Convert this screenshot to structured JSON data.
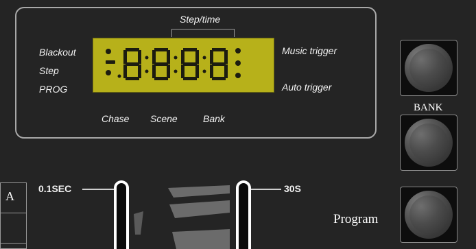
{
  "display": {
    "top_label": "Step/time",
    "left_labels": [
      "Blackout",
      "Step",
      "PROG"
    ],
    "right_labels": [
      "Music trigger",
      "Auto trigger"
    ],
    "bottom_labels": [
      "Chase",
      "Scene",
      "Bank"
    ],
    "segment_text": "8:8:8:8",
    "colors": {
      "lcd": "#b7b11a",
      "segments": "#1c1c10",
      "panel": "#242424"
    }
  },
  "buttons": {
    "bank_label": "BANK",
    "program_label": "Program",
    "side_mark": "A"
  },
  "faders": {
    "min_label": "0.1SEC",
    "max_label": "30S"
  }
}
